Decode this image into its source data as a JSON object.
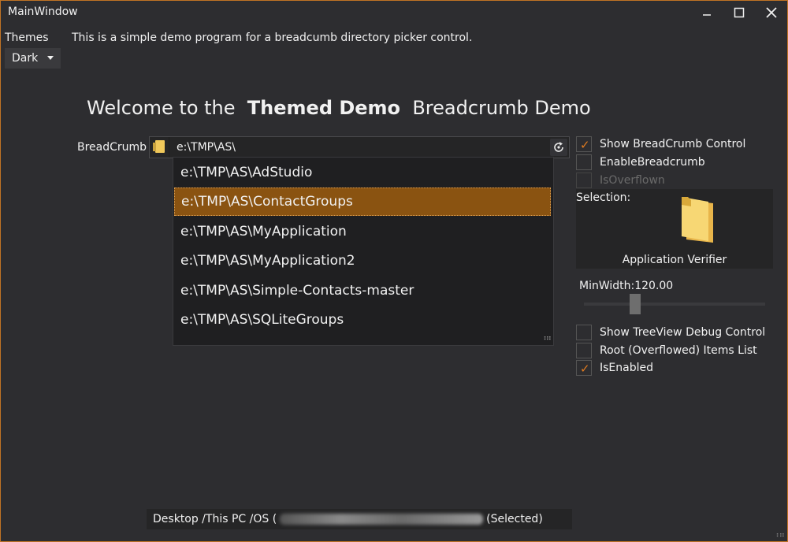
{
  "window": {
    "title": "MainWindow"
  },
  "themes": {
    "label": "Themes",
    "selected": "Dark"
  },
  "intro_text": "This is a simple demo program for a breadcumb directory picker control.",
  "heading": {
    "prefix": "Welcome to the",
    "bold": "Themed Demo",
    "suffix": "Breadcrumb Demo"
  },
  "breadcrumb": {
    "label": "BreadCrumb",
    "path": "e:\\TMP\\AS\\",
    "suggestions": [
      "e:\\TMP\\AS\\AdStudio",
      "e:\\TMP\\AS\\ContactGroups",
      "e:\\TMP\\AS\\MyApplication",
      "e:\\TMP\\AS\\MyApplication2",
      "e:\\TMP\\AS\\Simple-Contacts-master",
      "e:\\TMP\\AS\\SQLiteGroups"
    ],
    "selected_index": 1
  },
  "options_top": [
    {
      "label": "Show BreadCrumb Control",
      "checked": true,
      "enabled": true
    },
    {
      "label": "EnableBreadcrumb",
      "checked": false,
      "enabled": true
    },
    {
      "label": "IsOverflown",
      "checked": false,
      "enabled": false
    }
  ],
  "selection": {
    "label": "Selection:",
    "name": "Application Verifier"
  },
  "min_width": {
    "label": "MinWidth:120.00",
    "value": 120.0
  },
  "options_bottom": [
    {
      "label": "Show TreeView Debug Control",
      "checked": false
    },
    {
      "label": "Root (Overflowed) Items List",
      "checked": false
    },
    {
      "label": "IsEnabled",
      "checked": true
    }
  ],
  "status": {
    "prefix": "Desktop /This PC /OS (",
    "suffix": "(Selected)"
  },
  "colors": {
    "accent": "#e07b20",
    "selection_bg": "#8a5311",
    "background": "#2d2d30"
  }
}
